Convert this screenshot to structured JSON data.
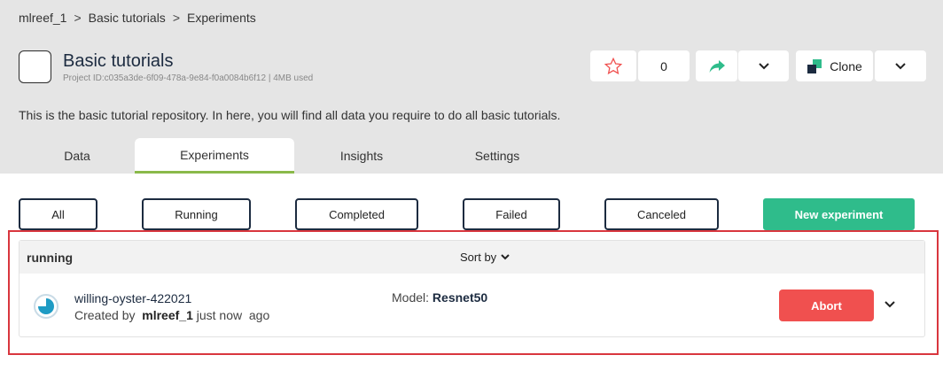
{
  "breadcrumb": {
    "item1": "mlreef_1",
    "item2": "Basic tutorials",
    "item3": "Experiments",
    "separator": ">"
  },
  "project": {
    "title": "Basic tutorials",
    "subtitle": "Project ID:c035a3de-6f09-478a-9e84-f0a0084b6f12 | 4MB used",
    "description": "This is the basic tutorial repository. In here, you will find all data you require to do all basic tutorials."
  },
  "actions": {
    "star_count": "0",
    "clone_label": "Clone"
  },
  "tabs": {
    "data": "Data",
    "experiments": "Experiments",
    "insights": "Insights",
    "settings": "Settings"
  },
  "filters": {
    "all": "All",
    "running": "Running",
    "completed": "Completed",
    "failed": "Failed",
    "canceled": "Canceled"
  },
  "new_experiment_label": "New experiment",
  "list": {
    "status_label": "running",
    "sort_label": "Sort by",
    "experiment": {
      "name": "willing-oyster-422021",
      "created_prefix": "Created by",
      "user": "mlreef_1",
      "time": "just now",
      "ago": "ago",
      "model_prefix": "Model:",
      "model": "Resnet50",
      "abort_label": "Abort"
    }
  },
  "colors": {
    "accent_green": "#2fbc8b",
    "tab_underline": "#8ab94a",
    "abort_red": "#f0504f",
    "highlight_red": "#d9363e"
  },
  "icons": [
    "star-icon",
    "share-icon",
    "chevron-down-icon",
    "clone-icon",
    "progress-pie-icon"
  ]
}
